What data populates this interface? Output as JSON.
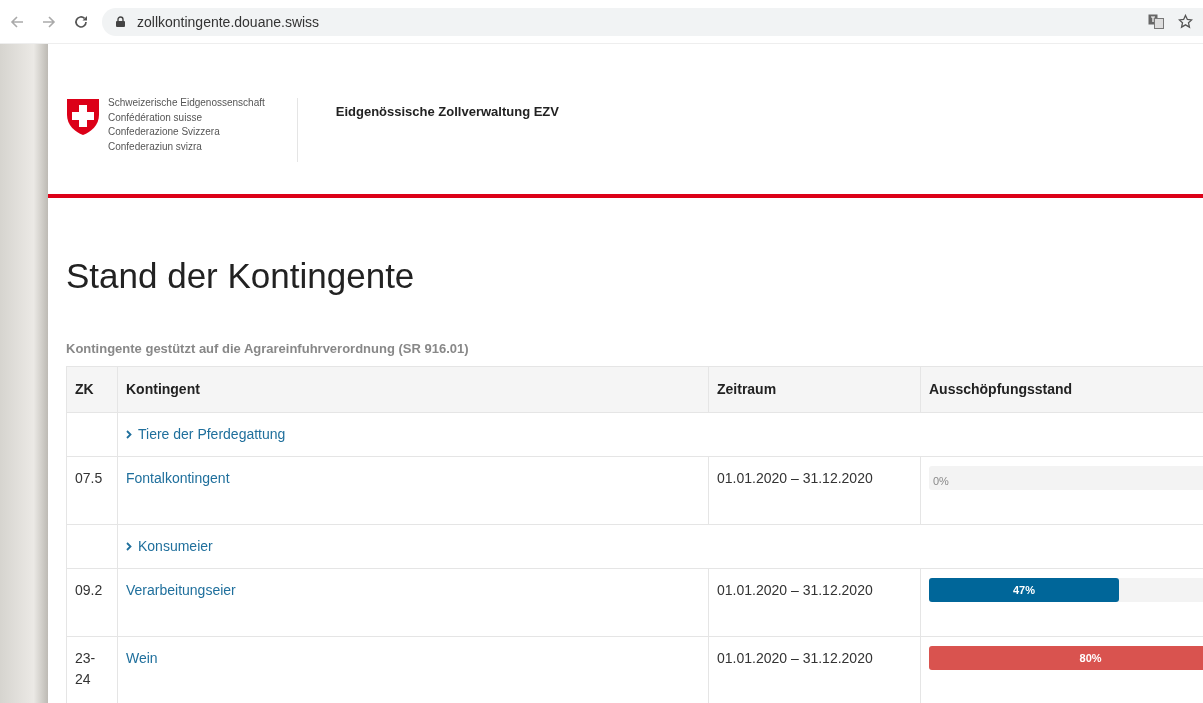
{
  "browser": {
    "url": "zollkontingente.douane.swiss"
  },
  "header": {
    "coat_lines": [
      "Schweizerische Eidgenossenschaft",
      "Confédération suisse",
      "Confederazione Svizzera",
      "Confederaziun svizra"
    ],
    "department": "Eidgenössische Zollverwaltung EZV"
  },
  "title": "Stand der Kontingente",
  "subtitle": "Kontingente gestützt auf die Agrareinfuhrverordnung (SR 916.01)",
  "table": {
    "columns": [
      "ZK",
      "Kontingent",
      "Zeitraum",
      "Ausschöpfungsstand"
    ],
    "rows": [
      {
        "kind": "group",
        "label": "Tiere der Pferdegattung"
      },
      {
        "kind": "quota",
        "zk": "07.5",
        "name": "Fontalkontingent",
        "period": "01.01.2020 – 31.12.2020",
        "level": 0,
        "reading": "0%"
      },
      {
        "kind": "group",
        "label": "Konsumeier"
      },
      {
        "kind": "quota",
        "zk": "09.2",
        "name": "Verarbeitungseier",
        "period": "01.01.2020 – 31.12.2020",
        "level": 0.47,
        "reading": "47%",
        "color": "#006699"
      },
      {
        "kind": "quota",
        "zk": "23-24",
        "name": "Wein",
        "period": "01.01.2020 – 31.12.2020",
        "level": 0.8,
        "reading": "80%",
        "color": "#d9534f"
      }
    ]
  }
}
